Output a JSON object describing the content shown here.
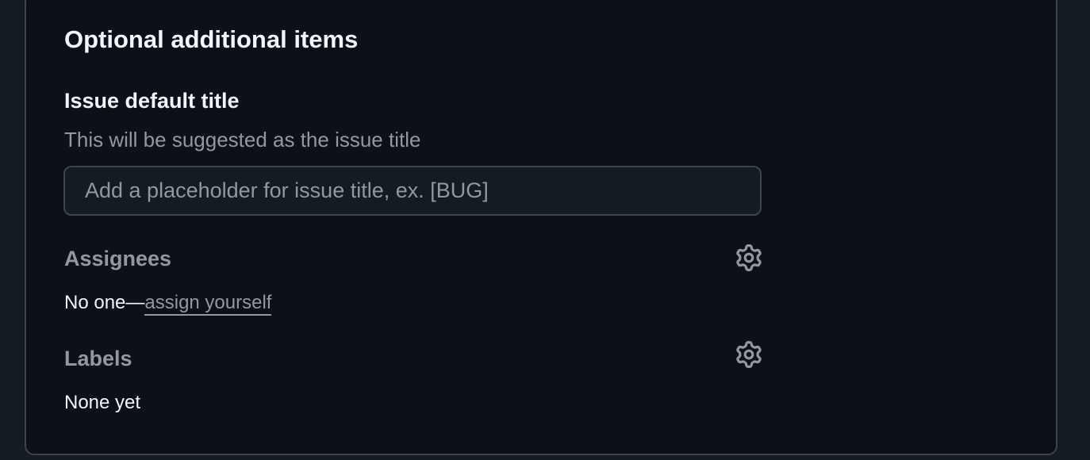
{
  "section": {
    "title": "Optional additional items"
  },
  "issue_title": {
    "label": "Issue default title",
    "description": "This will be suggested as the issue title",
    "placeholder": "Add a placeholder for issue title, ex. [BUG]",
    "value": ""
  },
  "assignees": {
    "heading": "Assignees",
    "icon": "gear-icon",
    "empty_prefix": "No one—",
    "assign_link": "assign yourself"
  },
  "labels": {
    "heading": "Labels",
    "icon": "gear-icon",
    "empty_text": "None yet"
  },
  "colors": {
    "background": "#0d1117",
    "border": "#3d444d",
    "text_primary": "#f0f6fc",
    "text_muted": "#9198a1"
  }
}
